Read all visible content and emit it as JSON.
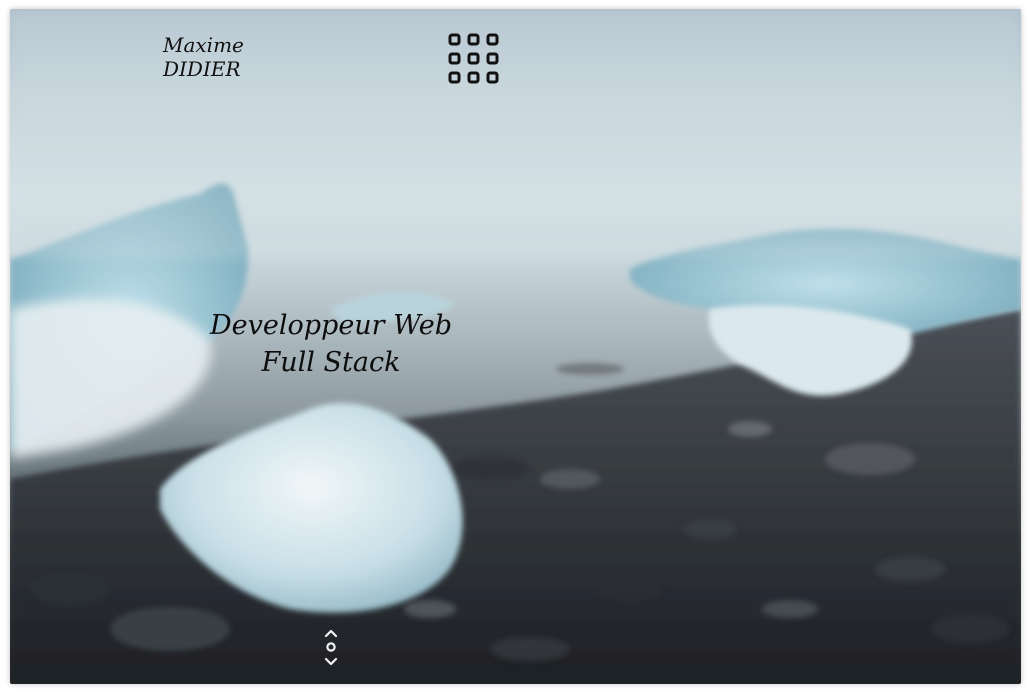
{
  "header": {
    "brand_first": "Maxime",
    "brand_last": "DIDIER",
    "menu_icon": "grid-menu-icon"
  },
  "hero": {
    "tagline_line1": "Developpeur Web",
    "tagline_line2": "Full Stack",
    "scroll_icon": "scroll-arrows-icon"
  },
  "colors": {
    "text": "#111111",
    "sky": "#d3e0e4",
    "ice": "#c6dfe7",
    "pebbles": "#25282d"
  }
}
